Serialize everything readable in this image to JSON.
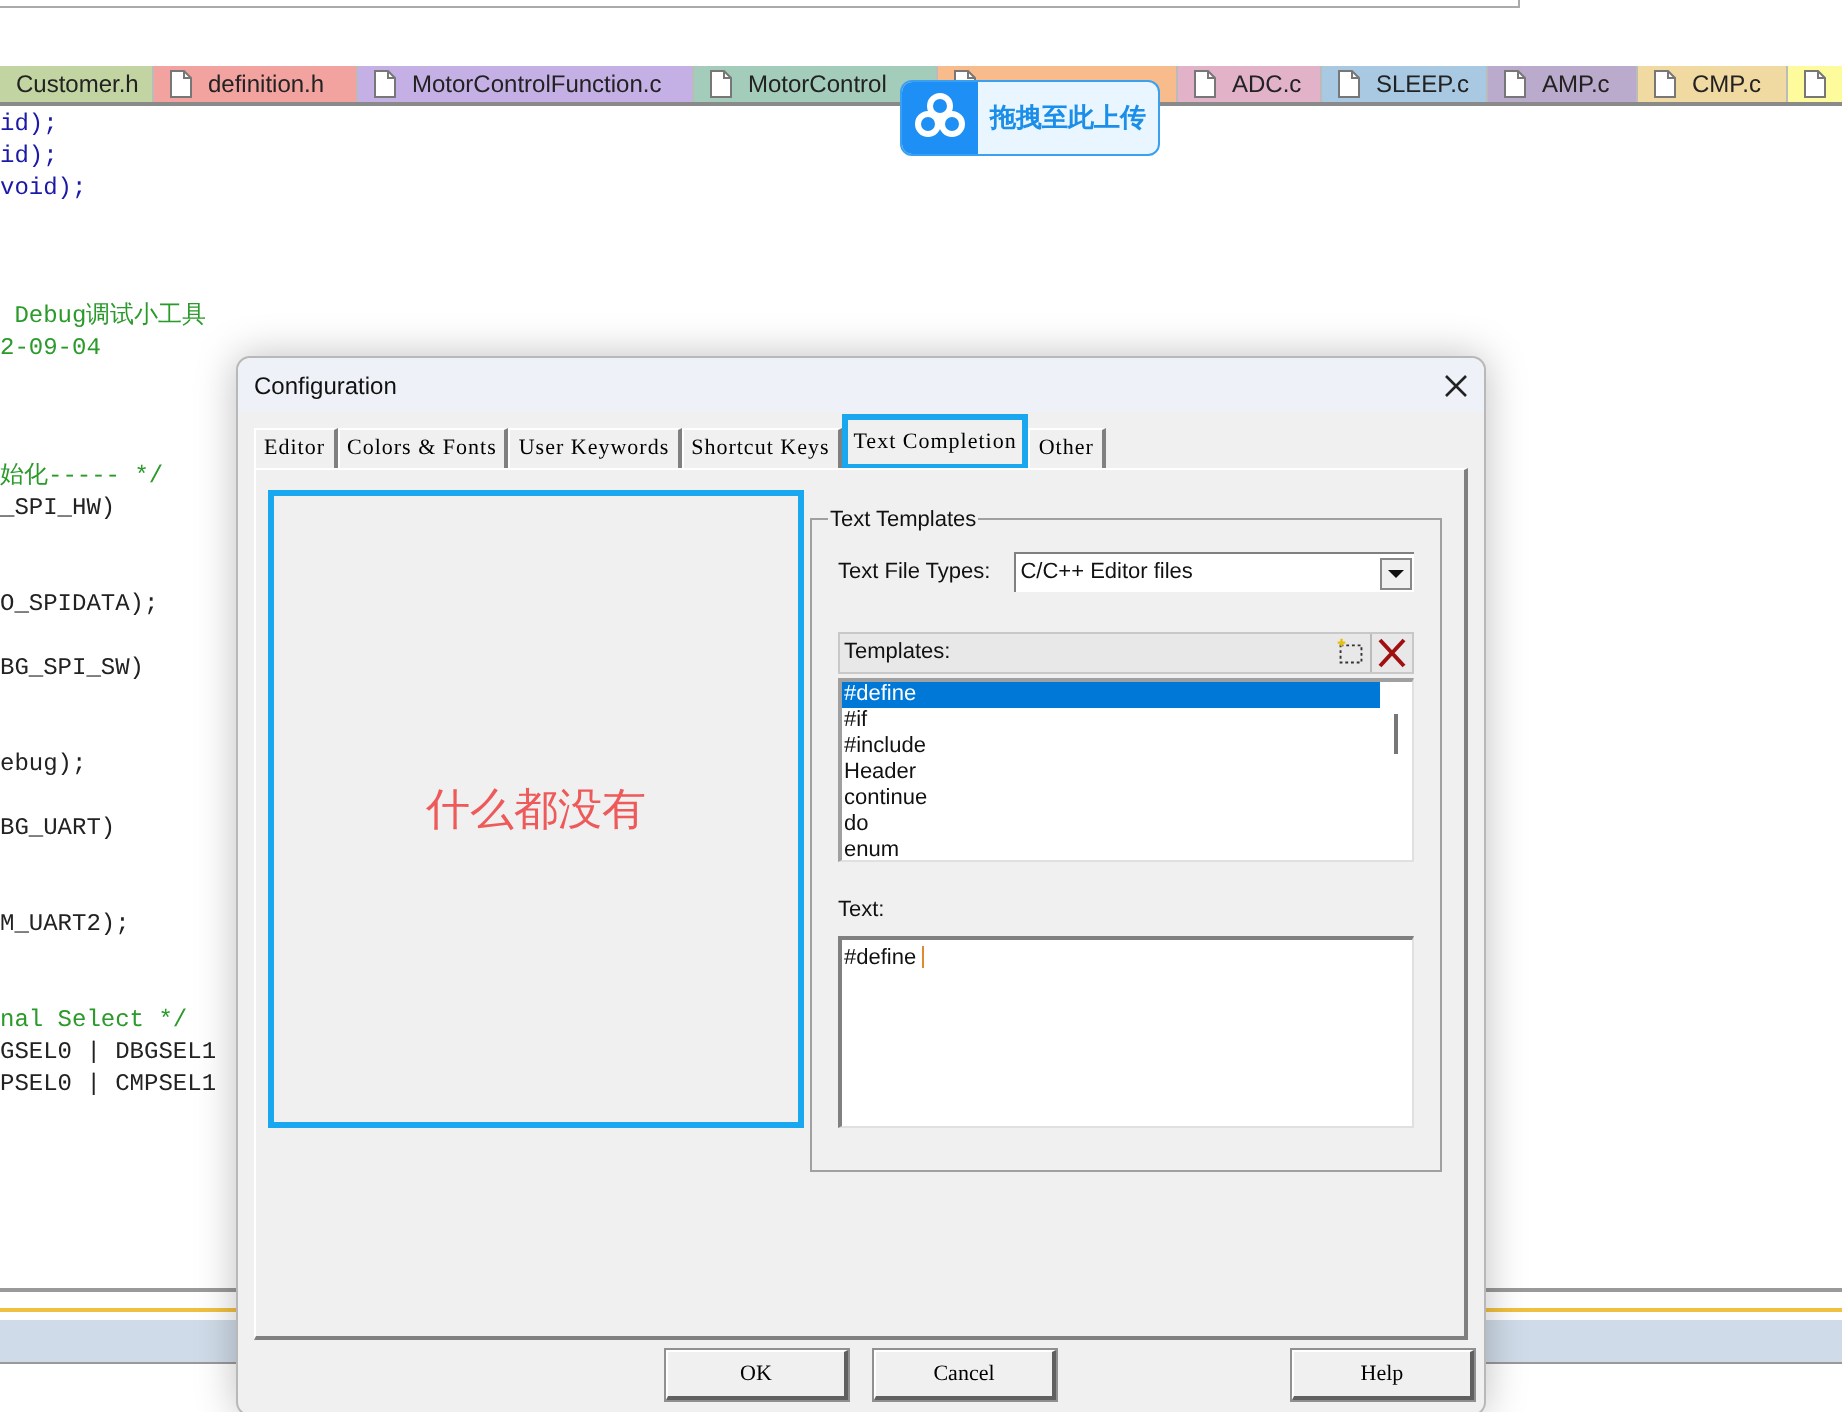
{
  "editor_tabs": [
    {
      "label": "Customer.h",
      "color": "#c2d4a2",
      "icon": false
    },
    {
      "label": "definition.h",
      "color": "#f2a3a0",
      "icon": true
    },
    {
      "label": "MotorControlFunction.c",
      "color": "#c4b0e4",
      "icon": true
    },
    {
      "label": "MotorControl",
      "color": "#a3ccbb",
      "icon": true
    },
    {
      "color": "#f8bb8c",
      "icon": true
    },
    {
      "label": "ADC.c",
      "color": "#e2b2c9",
      "icon": true
    },
    {
      "label": "SLEEP.c",
      "color": "#a9c9e2",
      "icon": true
    },
    {
      "label": "AMP.c",
      "color": "#baaacb",
      "icon": true
    },
    {
      "label": "CMP.c",
      "color": "#f1d9a2",
      "icon": true
    },
    {
      "color": "#fdfb9c",
      "icon": true
    }
  ],
  "upload_hint": {
    "label": "拖拽至此上传"
  },
  "code_lines": [
    {
      "text": "id);",
      "kind": "code"
    },
    {
      "text": "id);",
      "kind": "code"
    },
    {
      "text": "void);",
      "kind": "code"
    },
    {
      "text": " Debug调试小工具",
      "kind": "comment"
    },
    {
      "text": "2-09-04",
      "kind": "comment"
    },
    {
      "text": "始化----- */",
      "kind": "comment"
    },
    {
      "text": "_SPI_HW)",
      "kind": "plain"
    },
    {
      "text": "O_SPIDATA);",
      "kind": "plain"
    },
    {
      "text": "BG_SPI_SW)",
      "kind": "plain"
    },
    {
      "text": "ebug);",
      "kind": "plain"
    },
    {
      "text": "BG_UART)",
      "kind": "plain"
    },
    {
      "text": "M_UART2);",
      "kind": "plain"
    },
    {
      "text": "nal Select */",
      "kind": "comment"
    },
    {
      "text": "GSEL0 | DBGSEL1",
      "kind": "plain"
    },
    {
      "text": "PSEL0 | CMPSEL1",
      "kind": "plain"
    }
  ],
  "dialog": {
    "title": "Configuration",
    "tabs": [
      {
        "label": "Editor",
        "selected": false
      },
      {
        "label": "Colors & Fonts",
        "selected": false
      },
      {
        "label": "User Keywords",
        "selected": false
      },
      {
        "label": "Shortcut Keys",
        "selected": false
      },
      {
        "label": "Text Completion",
        "selected": true
      },
      {
        "label": "Other",
        "selected": false
      }
    ],
    "empty_panel": {
      "note": "什么都没有"
    },
    "text_templates": {
      "title": "Text Templates",
      "file_types_label": "Text File Types:",
      "file_types_value": "C/C++ Editor files",
      "templates_label": "Templates:",
      "templates": [
        {
          "label": "#define",
          "selected": true
        },
        {
          "label": "#if",
          "selected": false
        },
        {
          "label": "#include",
          "selected": false
        },
        {
          "label": "Header",
          "selected": false
        },
        {
          "label": "continue",
          "selected": false
        },
        {
          "label": "do",
          "selected": false
        },
        {
          "label": "enum",
          "selected": false
        }
      ],
      "text_label": "Text:",
      "text_value": "#define "
    },
    "buttons": [
      "OK",
      "Cancel",
      "Help"
    ]
  }
}
